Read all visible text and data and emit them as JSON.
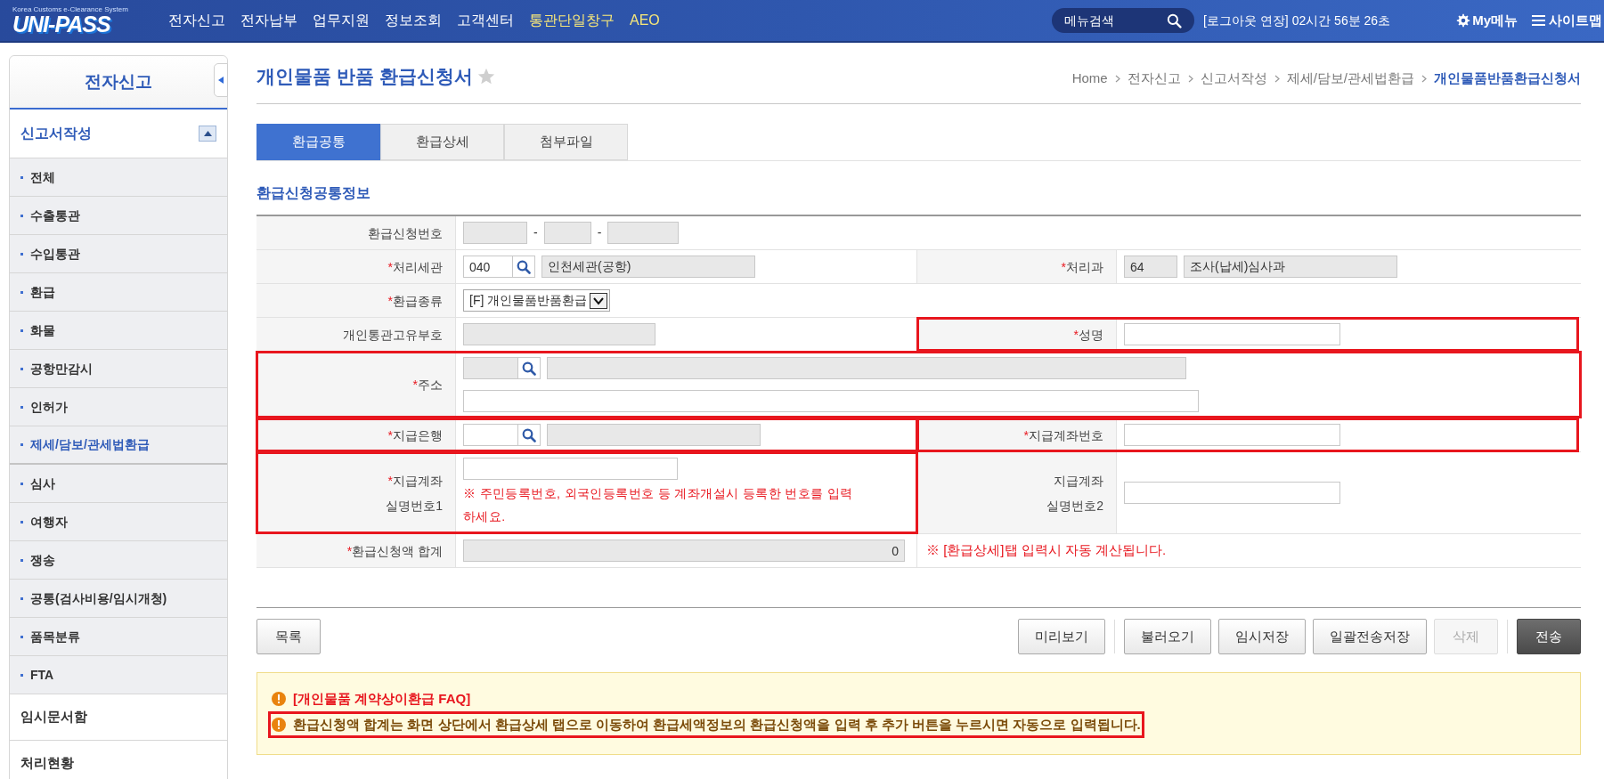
{
  "header": {
    "logo": {
      "tagline": "Korea Customs e-Clearance System",
      "name": "UNI-PASS"
    },
    "nav": [
      {
        "label": "전자신고",
        "accent": false
      },
      {
        "label": "전자납부",
        "accent": false
      },
      {
        "label": "업무지원",
        "accent": false
      },
      {
        "label": "정보조회",
        "accent": false
      },
      {
        "label": "고객센터",
        "accent": false
      },
      {
        "label": "통관단일창구",
        "accent": true
      },
      {
        "label": "AEO",
        "accent": true
      }
    ],
    "search": {
      "placeholder": "메뉴검색"
    },
    "session": "[로그아웃 연장] 02시간 56분 26초",
    "my_menu": "My메뉴",
    "sitemap": "사이트맵"
  },
  "sidebar": {
    "title": "전자신고",
    "section": {
      "label": "신고서작성",
      "expanded": true,
      "items": [
        {
          "label": "전체",
          "selected": false
        },
        {
          "label": "수출통관",
          "selected": false
        },
        {
          "label": "수입통관",
          "selected": false
        },
        {
          "label": "환급",
          "selected": false
        },
        {
          "label": "화물",
          "selected": false
        },
        {
          "label": "공항만감시",
          "selected": false
        },
        {
          "label": "인허가",
          "selected": false
        },
        {
          "label": "제세/담보/관세법환급",
          "selected": true
        },
        {
          "label": "심사",
          "selected": false
        },
        {
          "label": "여행자",
          "selected": false
        },
        {
          "label": "쟁송",
          "selected": false
        },
        {
          "label": "공통(검사비용/임시개청)",
          "selected": false
        },
        {
          "label": "품목분류",
          "selected": false
        },
        {
          "label": "FTA",
          "selected": false
        }
      ]
    },
    "links": [
      "임시문서함",
      "처리현황"
    ]
  },
  "page": {
    "title": "개인물품 반품 환급신청서",
    "favorite": false,
    "breadcrumb": [
      "Home",
      "전자신고",
      "신고서작성",
      "제세/담보/관세법환급",
      "개인물품반품환급신청서"
    ]
  },
  "tabs": [
    {
      "label": "환급공통",
      "selected": true
    },
    {
      "label": "환급상세",
      "selected": false
    },
    {
      "label": "첨부파일",
      "selected": false
    }
  ],
  "form": {
    "title": "환급신청공통정보",
    "rows": [
      {
        "fields": [
          {
            "label_lines": [
              "환급신청번호"
            ],
            "highlighted": false,
            "inputs": [
              {
                "kind": "text",
                "disabled": true
              },
              {
                "kind": "sep",
                "text": "-"
              },
              {
                "kind": "text",
                "disabled": true
              },
              {
                "kind": "sep",
                "text": "-"
              },
              {
                "kind": "text",
                "disabled": true
              }
            ]
          }
        ]
      },
      {
        "fields": [
          {
            "marker": "*",
            "label_lines": [
              "처리세관"
            ],
            "highlighted": false,
            "inputs": [
              {
                "kind": "search",
                "value": "040",
                "disabled": false
              },
              {
                "kind": "text",
                "value": "인천세관(공항)",
                "disabled": true
              }
            ]
          },
          {
            "marker": "*",
            "label_lines": [
              "처리과"
            ],
            "highlighted": false,
            "inputs": [
              {
                "kind": "text",
                "value": "64",
                "disabled": true
              },
              {
                "kind": "text",
                "value": "조사(납세)심사과",
                "disabled": true
              }
            ]
          }
        ]
      },
      {
        "fields": [
          {
            "marker": "*",
            "label_lines": [
              "환급종류"
            ],
            "highlighted": false,
            "inputs": [
              {
                "kind": "select",
                "value": "[F] 개인물품반품환급",
                "disabled": false
              }
            ]
          }
        ]
      },
      {
        "fields": [
          {
            "label_lines": [
              "개인통관고유부호"
            ],
            "highlighted": false,
            "inputs": [
              {
                "kind": "text",
                "disabled": true
              }
            ]
          },
          {
            "marker": "*",
            "label_lines": [
              "성명"
            ],
            "highlighted": true,
            "inputs": [
              {
                "kind": "text",
                "disabled": false
              }
            ]
          }
        ]
      },
      {
        "fields": [
          {
            "marker": "*",
            "label_lines": [
              "주소"
            ],
            "highlighted": true,
            "inputs": [
              {
                "kind": "search",
                "disabled": true
              },
              {
                "kind": "text",
                "disabled": true
              },
              {
                "kind": "break"
              },
              {
                "kind": "text",
                "disabled": false
              }
            ]
          }
        ]
      },
      {
        "fields": [
          {
            "marker": "*",
            "label_lines": [
              "지급은행"
            ],
            "highlighted": true,
            "inputs": [
              {
                "kind": "search",
                "disabled": false
              },
              {
                "kind": "text",
                "disabled": true
              }
            ]
          },
          {
            "marker": "*",
            "label_lines": [
              "지급계좌번호"
            ],
            "highlighted": true,
            "inputs": [
              {
                "kind": "text",
                "disabled": false
              }
            ]
          }
        ]
      },
      {
        "fields": [
          {
            "marker": "*",
            "label_lines": [
              "지급계좌",
              "실명번호1"
            ],
            "highlighted": true,
            "inputs": [
              {
                "kind": "text",
                "disabled": false
              }
            ],
            "note": "※ 주민등록번호, 외국인등록번호 등 계좌개설시 등록한 번호를 입력하세요."
          },
          {
            "label_lines": [
              "지급계좌",
              "실명번호2"
            ],
            "highlighted": false,
            "inputs": [
              {
                "kind": "text",
                "disabled": false
              }
            ]
          }
        ]
      },
      {
        "fields": [
          {
            "marker": "*",
            "label_lines": [
              "환급신청액 합계"
            ],
            "highlighted": false,
            "inputs": [
              {
                "kind": "amount",
                "value": "0",
                "disabled": true
              }
            ],
            "aside_note": "※ [환급상세]탭 입력시 자동 계산됩니다."
          }
        ]
      }
    ]
  },
  "buttons_left": [
    {
      "label": "목록",
      "kind": "default",
      "disabled": false
    }
  ],
  "button_groups": [
    {
      "buttons": [
        {
          "label": "미리보기",
          "kind": "default",
          "disabled": false
        }
      ]
    },
    {
      "buttons": [
        {
          "label": "불러오기",
          "kind": "default",
          "disabled": false
        },
        {
          "label": "임시저장",
          "kind": "default",
          "disabled": false
        },
        {
          "label": "일괄전송저장",
          "kind": "default",
          "disabled": false
        },
        {
          "label": "삭제",
          "kind": "default",
          "disabled": true
        }
      ]
    },
    {
      "buttons": [
        {
          "label": "전송",
          "kind": "primary",
          "disabled": false
        }
      ]
    }
  ],
  "notices": [
    {
      "kind": "link",
      "text": "[개인물품 계약상이환급 FAQ]",
      "highlighted": false
    },
    {
      "kind": "text",
      "text": "환급신청액 합계는 화면 상단에서 환급상세 탭으로 이동하여 환급세액정보의 환급신청액을 입력 후 추가 버튼을 누르시면 자동으로 입력됩니다.",
      "highlighted": true
    }
  ]
}
